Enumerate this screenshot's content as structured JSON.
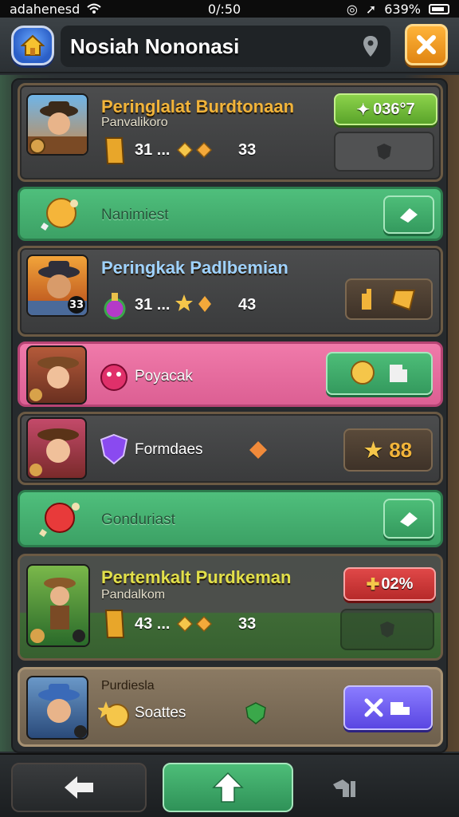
{
  "status_bar": {
    "carrier": "adahenesd",
    "time": "0/:50",
    "battery": "639%"
  },
  "header": {
    "title": "Nosiah Nononasi"
  },
  "rows": {
    "r1": {
      "title": "Peringlalat Burdtonaan",
      "subtitle": "Panvalikoro",
      "stat_a": "31 ...",
      "stat_b": "33",
      "button": "036°7"
    },
    "r2": {
      "label": "Nanimiest"
    },
    "r3": {
      "title": "Peringkak Padlbemian",
      "stat_a": "31 ...",
      "stat_b": "43",
      "badge": "33"
    },
    "r4": {
      "label": "Poyacak"
    },
    "r5": {
      "label": "Formdaes",
      "button": "88"
    },
    "r6": {
      "label": "Gonduriast"
    },
    "r7": {
      "title": "Pertemkalt Purdkeman",
      "subtitle": "Pandalkom",
      "stat_a": "43 ...",
      "stat_b": "33",
      "button": "02%"
    },
    "r8": {
      "subtitle": "Purdiesla",
      "label": "Soattes"
    }
  },
  "colors": {
    "gold_title": "#f2b43a",
    "blue_title": "#9fd2ff",
    "yellow_title": "#e2e04a"
  }
}
